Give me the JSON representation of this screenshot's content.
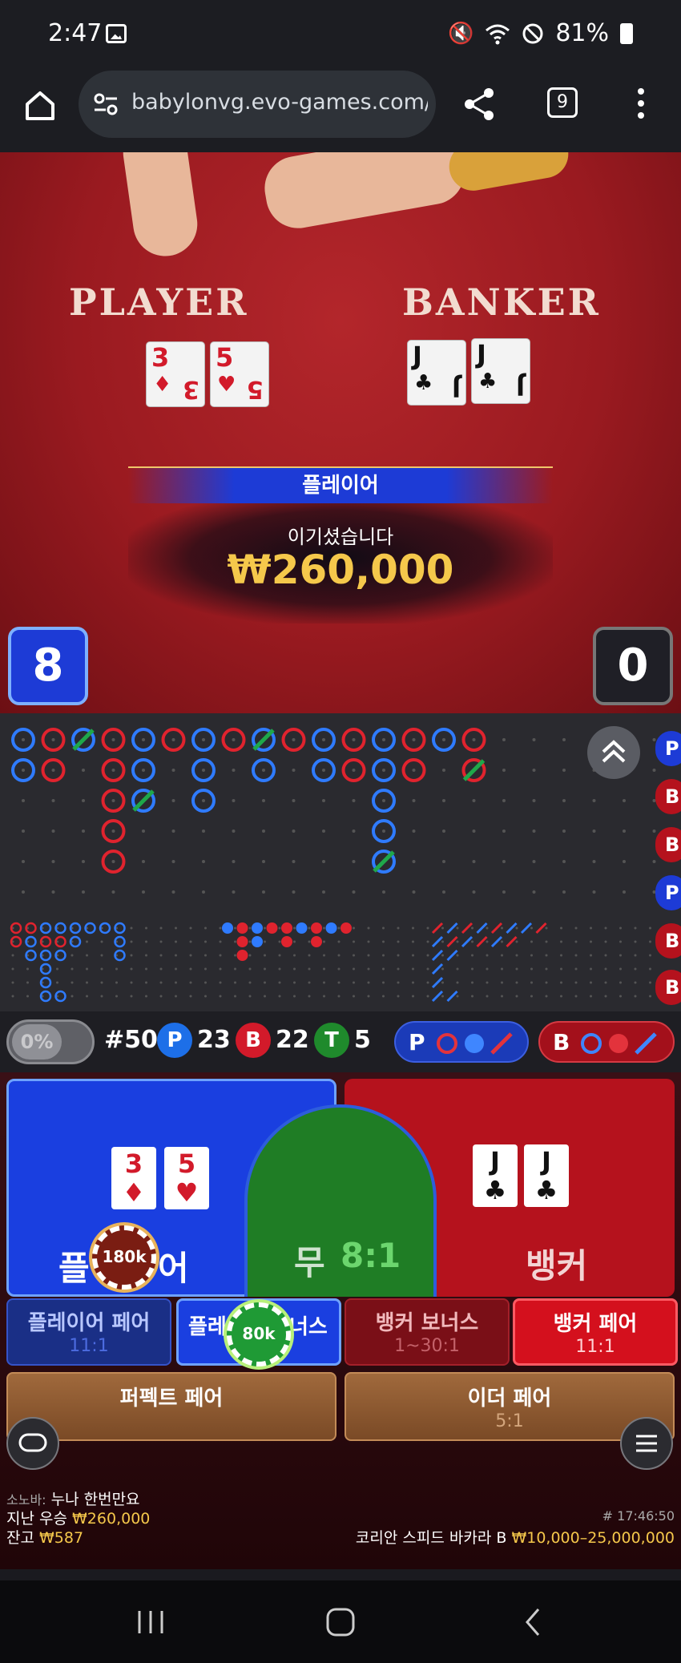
{
  "status_bar": {
    "time": "2:47",
    "battery": "81%",
    "icons": [
      "gallery-icon",
      "mute-icon",
      "wifi-icon",
      "do-not-disturb-icon",
      "battery-icon"
    ]
  },
  "browser": {
    "url": "babylonvg.evo-games.com/fro",
    "tab_count": "9"
  },
  "video": {
    "player_label": "PLAYER",
    "banker_label": "BANKER",
    "player_cards": [
      {
        "rank": "3",
        "suit": "♦"
      },
      {
        "rank": "5",
        "suit": "♥"
      }
    ],
    "banker_cards": [
      {
        "rank": "J",
        "suit": "♣"
      },
      {
        "rank": "J",
        "suit": "♣"
      }
    ],
    "winner_banner": "플레이어",
    "win_message": "이기셨습니다",
    "win_amount": "₩260,000",
    "player_score": "8",
    "banker_score": "0"
  },
  "side_chips": [
    "P",
    "B",
    "B",
    "P",
    "B",
    "B"
  ],
  "stats": {
    "toggle_label": "0%",
    "total": "#50",
    "player_label": "P",
    "player_count": "23",
    "banker_label": "B",
    "banker_count": "22",
    "tie_label": "T",
    "tie_count": "5",
    "player_predict": "P",
    "banker_predict": "B"
  },
  "bets": {
    "player": {
      "label_start": "플",
      "label_end": "어",
      "cards": [
        {
          "rank": "3",
          "suit": "♦"
        },
        {
          "rank": "5",
          "suit": "♥"
        }
      ],
      "chip": "180k"
    },
    "tie": {
      "label": "무",
      "odds": "8:1"
    },
    "banker": {
      "label": "뱅커",
      "cards": [
        {
          "rank": "J",
          "suit": "♣"
        },
        {
          "rank": "J",
          "suit": "♣"
        }
      ]
    },
    "player_pair": {
      "label": "플레이어 페어",
      "odds": "11:1"
    },
    "player_bonus": {
      "label_start": "플레",
      "label_end": "너스",
      "chip": "80k"
    },
    "banker_bonus": {
      "label": "뱅커 보너스",
      "odds": "1~30:1"
    },
    "banker_pair": {
      "label": "뱅커 페어",
      "odds": "11:1"
    },
    "perfect_pair": {
      "label": "퍼펙트 페어"
    },
    "either_pair": {
      "label": "이더 페어",
      "odds": "5:1"
    }
  },
  "footer": {
    "chat_user": "소노바:",
    "chat_message": "누나 한번만요",
    "last_win_label": "지난 우승",
    "last_win_amount": "₩260,000",
    "balance_label": "잔고",
    "balance_amount": "₩587",
    "round_id": "# 17:46:50",
    "table_name": "코리안 스피드 바카라 B",
    "table_limits": "₩10,000–25,000,000"
  },
  "colors": {
    "player_blue": "#1a3fe0",
    "banker_red": "#b5121d",
    "tie_green": "#1f7d25",
    "gold": "#f5c84b"
  }
}
